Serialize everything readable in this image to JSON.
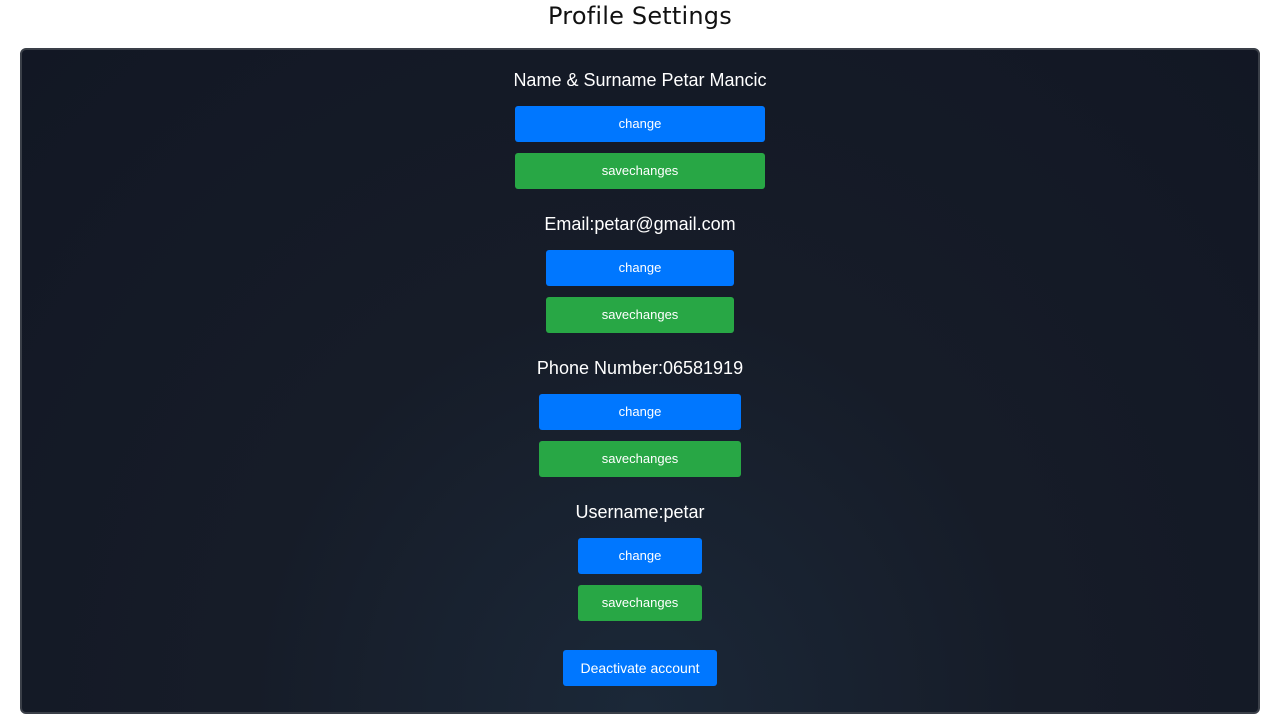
{
  "page": {
    "title": "Profile Settings"
  },
  "sections": [
    {
      "label": "Name & Surname Petar Mancic",
      "change_label": "change",
      "save_label": "savechanges"
    },
    {
      "label": "Email:petar@gmail.com",
      "change_label": "change",
      "save_label": "savechanges"
    },
    {
      "label": "Phone Number:06581919",
      "change_label": "change",
      "save_label": "savechanges"
    },
    {
      "label": "Username:petar",
      "change_label": "change",
      "save_label": "savechanges"
    }
  ],
  "deactivate": {
    "label": "Deactivate account"
  },
  "colors": {
    "change_button": "#0077ff",
    "save_button": "#28a745",
    "panel_background": "#151b27",
    "label_text": "#ffffff"
  }
}
